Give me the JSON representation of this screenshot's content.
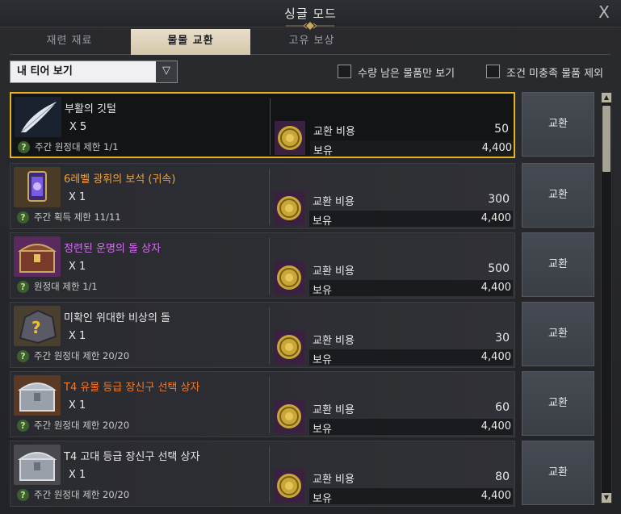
{
  "window": {
    "title": "싱글 모드",
    "close_symbol": "X"
  },
  "tabs": [
    {
      "label": "재련 재료"
    },
    {
      "label": "물물 교환"
    },
    {
      "label": "고유 보상"
    }
  ],
  "filters": {
    "tier_dropdown": "내 티어 보기",
    "checkbox_remaining": "수량 남은 물품만 보기",
    "checkbox_exclude": "조건 미충족 물품 제외"
  },
  "items": [
    {
      "name": "부활의 깃털",
      "name_color": "#ffffff",
      "qty": "X 5",
      "limit": "주간 원정대 제한 1/1",
      "cost_label": "교환 비용",
      "cost": "50",
      "have_label": "보유",
      "have": "4,400",
      "button": "교환"
    },
    {
      "name": "6레벨 광휘의 보석 (귀속)",
      "name_color": "#f2a23a",
      "qty": "X 1",
      "limit": "주간 획득 제한 11/11",
      "cost_label": "교환 비용",
      "cost": "300",
      "have_label": "보유",
      "have": "4,400",
      "button": "교환"
    },
    {
      "name": "정련된 운명의 돌 상자",
      "name_color": "#d86df3",
      "qty": "X 1",
      "limit": "원정대 제한 1/1",
      "cost_label": "교환 비용",
      "cost": "500",
      "have_label": "보유",
      "have": "4,400",
      "button": "교환"
    },
    {
      "name": "미확인 위대한 비상의 돌",
      "name_color": "#ffffff",
      "qty": "X 1",
      "limit": "주간 원정대 제한 20/20",
      "cost_label": "교환 비용",
      "cost": "30",
      "have_label": "보유",
      "have": "4,400",
      "button": "교환"
    },
    {
      "name": "T4 유물 등급 장신구 선택 상자",
      "name_color": "#f07a2c",
      "qty": "X 1",
      "limit": "주간 원정대 제한 20/20",
      "cost_label": "교환 비용",
      "cost": "60",
      "have_label": "보유",
      "have": "4,400",
      "button": "교환"
    },
    {
      "name": "T4 고대 등급 장신구 선택 상자",
      "name_color": "#ffffff",
      "qty": "X 1",
      "limit": "주간 원정대 제한 20/20",
      "cost_label": "교환 비용",
      "cost": "80",
      "have_label": "보유",
      "have": "4,400",
      "button": "교환"
    }
  ]
}
